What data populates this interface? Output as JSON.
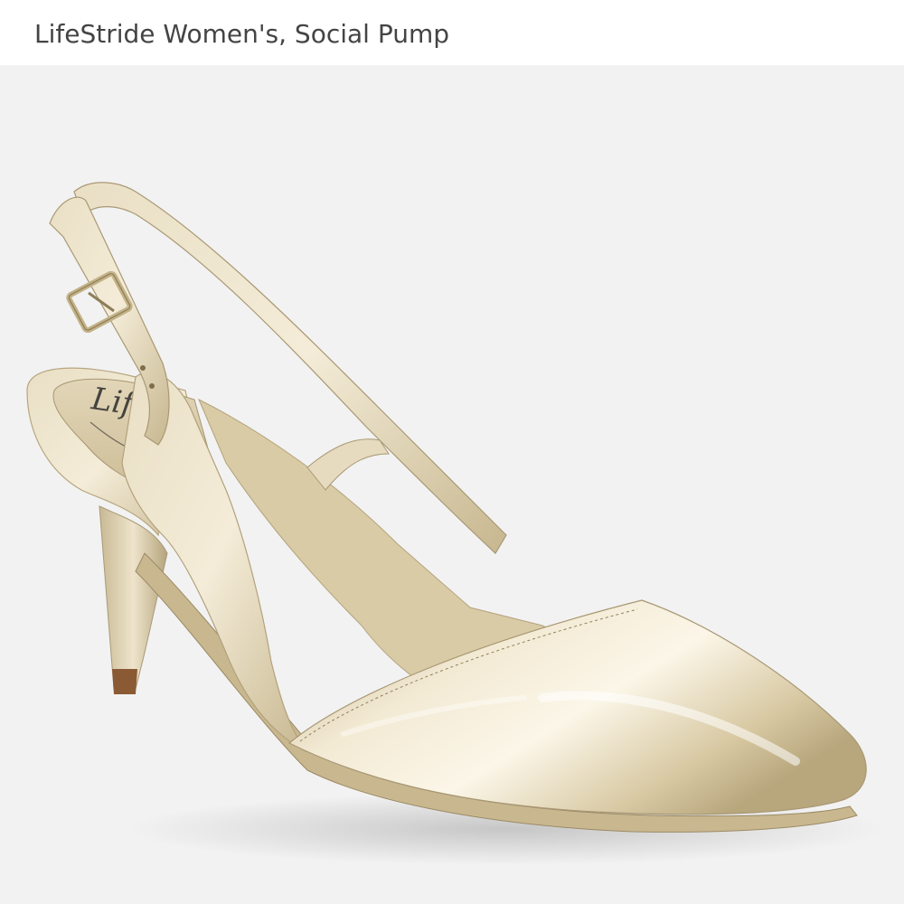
{
  "header": {
    "product_title": "LifeStride Women's, Social Pump"
  },
  "product_image": {
    "subject": "shoe-image",
    "brand_mark": "Life",
    "colors": {
      "background": "#f2f2f2",
      "upper_light": "#f1e8d2",
      "upper_mid": "#d9cba7",
      "upper_dark": "#a89a78",
      "lining": "#d6c7a3",
      "heel_tip": "#8a5a35",
      "sole": "#c9b88f"
    }
  }
}
